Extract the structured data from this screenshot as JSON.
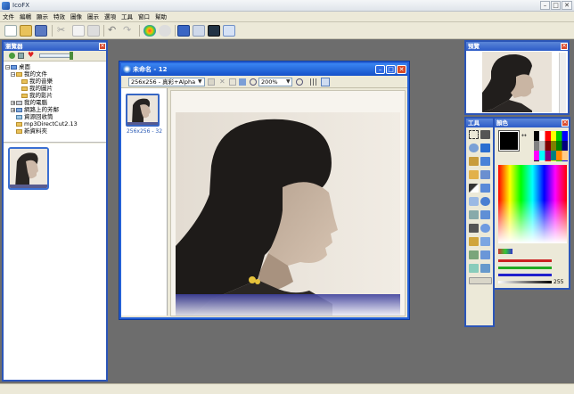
{
  "app": {
    "title": "IcoFX"
  },
  "menu": [
    "文件",
    "編輯",
    "顯示",
    "特效",
    "圖像",
    "圖示",
    "選項",
    "工具",
    "窗口",
    "幫助"
  ],
  "browser": {
    "title": "瀏覽器",
    "tree": [
      {
        "label": "桌面",
        "level": 0
      },
      {
        "label": "我的文件",
        "level": 1
      },
      {
        "label": "我的音樂",
        "level": 2
      },
      {
        "label": "我的圖片",
        "level": 2
      },
      {
        "label": "我的影片",
        "level": 2
      },
      {
        "label": "我的電腦",
        "level": 1
      },
      {
        "label": "網路上的芳鄰",
        "level": 1
      },
      {
        "label": "資源回收筒",
        "level": 1
      },
      {
        "label": "mp3DirectCut2.13",
        "level": 1
      },
      {
        "label": "新資料夾",
        "level": 1
      }
    ]
  },
  "document": {
    "title": "未命名 - 12",
    "format_select": "256x256 - 真彩+Alpha",
    "zoom": "200%",
    "thumb_caption": "256x256 - 32"
  },
  "preview": {
    "title": "預覽"
  },
  "tools": {
    "title": "工具"
  },
  "colors": {
    "title": "顏色",
    "alpha_value": "255"
  }
}
